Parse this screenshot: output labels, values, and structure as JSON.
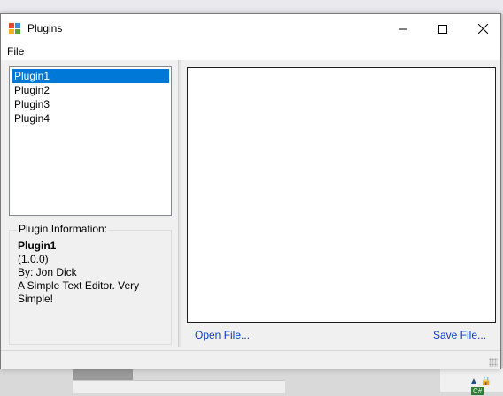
{
  "window": {
    "title": "Plugins",
    "app_icon": "windows-form-icon",
    "controls": {
      "minimize": "—",
      "maximize": "☐",
      "close": "✕"
    }
  },
  "menu": {
    "file": "File"
  },
  "plugins": {
    "items": [
      {
        "label": "Plugin1",
        "selected": true
      },
      {
        "label": "Plugin2",
        "selected": false
      },
      {
        "label": "Plugin3",
        "selected": false
      },
      {
        "label": "Plugin4",
        "selected": false
      }
    ]
  },
  "plugin_info": {
    "legend": "Plugin Information:",
    "name": "Plugin1",
    "version": "(1.0.0)",
    "author": "By: Jon Dick",
    "description": "A Simple Text Editor. Very Simple!"
  },
  "editor": {
    "open_link": "Open File...",
    "save_link": "Save File..."
  },
  "colors": {
    "selection": "#0078d7",
    "link": "#0a3ec9",
    "window_bg": "#f0f0f0"
  }
}
